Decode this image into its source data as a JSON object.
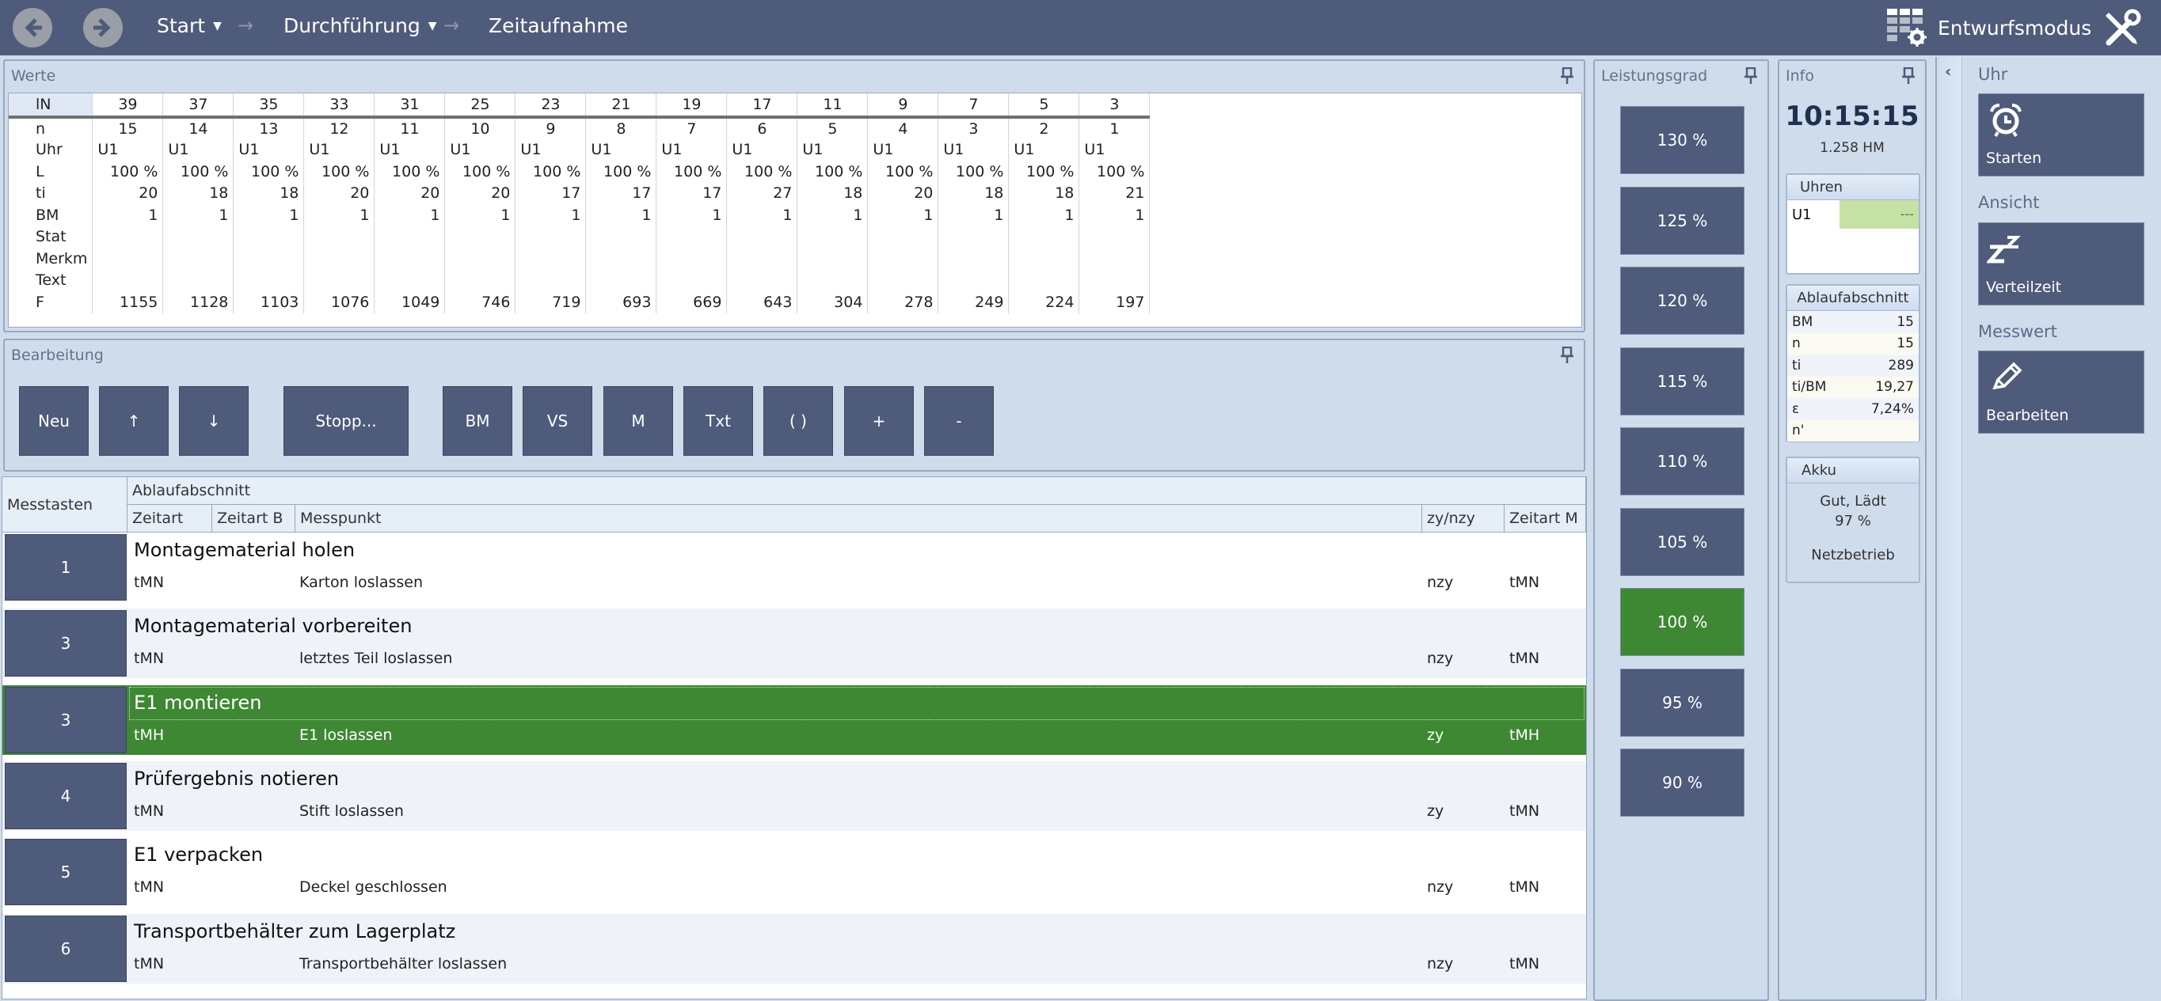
{
  "header": {
    "breadcrumbs": [
      {
        "label": "Start",
        "has_dropdown": true
      },
      {
        "label": "Durchführung",
        "has_dropdown": true
      },
      {
        "label": "Zeitaufnahme",
        "has_dropdown": false
      }
    ],
    "design_mode_label": "Entwurfsmodus",
    "icons": {
      "back": "arrow-left-circle-icon",
      "forward": "arrow-right-circle-icon",
      "design": "grid-gear-icon",
      "tools": "wrench-screwdriver-icon"
    }
  },
  "werte": {
    "title": "Werte",
    "row_labels": [
      "lN",
      "n",
      "Uhr",
      "L",
      "ti",
      "BM",
      "Stat",
      "Merkm",
      "Text",
      "F"
    ],
    "columns": [
      {
        "lN": "39",
        "n": "15",
        "Uhr": "U1",
        "L": "100 %",
        "ti": "20",
        "BM": "1",
        "Stat": "",
        "Merkm": "",
        "Text": "",
        "F": "1155"
      },
      {
        "lN": "37",
        "n": "14",
        "Uhr": "U1",
        "L": "100 %",
        "ti": "18",
        "BM": "1",
        "Stat": "",
        "Merkm": "",
        "Text": "",
        "F": "1128"
      },
      {
        "lN": "35",
        "n": "13",
        "Uhr": "U1",
        "L": "100 %",
        "ti": "18",
        "BM": "1",
        "Stat": "",
        "Merkm": "",
        "Text": "",
        "F": "1103"
      },
      {
        "lN": "33",
        "n": "12",
        "Uhr": "U1",
        "L": "100 %",
        "ti": "20",
        "BM": "1",
        "Stat": "",
        "Merkm": "",
        "Text": "",
        "F": "1076"
      },
      {
        "lN": "31",
        "n": "11",
        "Uhr": "U1",
        "L": "100 %",
        "ti": "20",
        "BM": "1",
        "Stat": "",
        "Merkm": "",
        "Text": "",
        "F": "1049"
      },
      {
        "lN": "25",
        "n": "10",
        "Uhr": "U1",
        "L": "100 %",
        "ti": "20",
        "BM": "1",
        "Stat": "",
        "Merkm": "",
        "Text": "",
        "F": "746"
      },
      {
        "lN": "23",
        "n": "9",
        "Uhr": "U1",
        "L": "100 %",
        "ti": "17",
        "BM": "1",
        "Stat": "",
        "Merkm": "",
        "Text": "",
        "F": "719"
      },
      {
        "lN": "21",
        "n": "8",
        "Uhr": "U1",
        "L": "100 %",
        "ti": "17",
        "BM": "1",
        "Stat": "",
        "Merkm": "",
        "Text": "",
        "F": "693"
      },
      {
        "lN": "19",
        "n": "7",
        "Uhr": "U1",
        "L": "100 %",
        "ti": "17",
        "BM": "1",
        "Stat": "",
        "Merkm": "",
        "Text": "",
        "F": "669"
      },
      {
        "lN": "17",
        "n": "6",
        "Uhr": "U1",
        "L": "100 %",
        "ti": "27",
        "BM": "1",
        "Stat": "",
        "Merkm": "",
        "Text": "",
        "F": "643"
      },
      {
        "lN": "11",
        "n": "5",
        "Uhr": "U1",
        "L": "100 %",
        "ti": "18",
        "BM": "1",
        "Stat": "",
        "Merkm": "",
        "Text": "",
        "F": "304"
      },
      {
        "lN": "9",
        "n": "4",
        "Uhr": "U1",
        "L": "100 %",
        "ti": "20",
        "BM": "1",
        "Stat": "",
        "Merkm": "",
        "Text": "",
        "F": "278"
      },
      {
        "lN": "7",
        "n": "3",
        "Uhr": "U1",
        "L": "100 %",
        "ti": "18",
        "BM": "1",
        "Stat": "",
        "Merkm": "",
        "Text": "",
        "F": "249"
      },
      {
        "lN": "5",
        "n": "2",
        "Uhr": "U1",
        "L": "100 %",
        "ti": "18",
        "BM": "1",
        "Stat": "",
        "Merkm": "",
        "Text": "",
        "F": "224"
      },
      {
        "lN": "3",
        "n": "1",
        "Uhr": "U1",
        "L": "100 %",
        "ti": "21",
        "BM": "1",
        "Stat": "",
        "Merkm": "",
        "Text": "",
        "F": "197"
      }
    ]
  },
  "bearbeitung": {
    "title": "Bearbeitung",
    "buttons": [
      "Neu",
      "↑",
      "↓",
      "Stopp...",
      "BM",
      "VS",
      "M",
      "Txt",
      "( )",
      "+",
      "-"
    ]
  },
  "grid": {
    "headers": {
      "messtasten": "Messtasten",
      "ablaufabschnitt": "Ablaufabschnitt",
      "zeitart": "Zeitart",
      "zeitart_b": "Zeitart B",
      "messpunkt": "Messpunkt",
      "zy_nzy": "zy/nzy",
      "zeitart_m": "Zeitart M"
    },
    "rows": [
      {
        "key": "1",
        "title": "Montagematerial holen",
        "zeitart": "tMN",
        "zeitart_b": "",
        "messpunkt": "Karton loslassen",
        "zy": "nzy",
        "zeitart_m": "tMN",
        "selected": false
      },
      {
        "key": "3",
        "title": "Montagematerial vorbereiten",
        "zeitart": "tMN",
        "zeitart_b": "",
        "messpunkt": "letztes Teil loslassen",
        "zy": "nzy",
        "zeitart_m": "tMN",
        "selected": false
      },
      {
        "key": "3",
        "title": "E1 montieren",
        "zeitart": "tMH",
        "zeitart_b": "",
        "messpunkt": "E1 loslassen",
        "zy": "zy",
        "zeitart_m": "tMH",
        "selected": true
      },
      {
        "key": "4",
        "title": "Prüfergebnis notieren",
        "zeitart": "tMN",
        "zeitart_b": "",
        "messpunkt": "Stift loslassen",
        "zy": "zy",
        "zeitart_m": "tMN",
        "selected": false
      },
      {
        "key": "5",
        "title": "E1 verpacken",
        "zeitart": "tMN",
        "zeitart_b": "",
        "messpunkt": "Deckel geschlossen",
        "zy": "nzy",
        "zeitart_m": "tMN",
        "selected": false
      },
      {
        "key": "6",
        "title": "Transportbehälter zum Lagerplatz",
        "zeitart": "tMN",
        "zeitart_b": "",
        "messpunkt": "Transportbehälter loslassen",
        "zy": "nzy",
        "zeitart_m": "tMN",
        "selected": false
      }
    ]
  },
  "leistungsgrad": {
    "title": "Leistungsgrad",
    "options": [
      "130 %",
      "125 %",
      "120 %",
      "115 %",
      "110 %",
      "105 %",
      "100 %",
      "95 %",
      "90 %"
    ],
    "selected": "100 %"
  },
  "info": {
    "title": "Info",
    "time": "10:15:15",
    "hm": "1.258 HM",
    "uhren": {
      "title": "Uhren",
      "rows": [
        {
          "label": "U1",
          "value": "---"
        }
      ]
    },
    "ablaufabschnitt": {
      "title": "Ablaufabschnitt",
      "rows": [
        {
          "label": "BM",
          "value": "15"
        },
        {
          "label": "n",
          "value": "15"
        },
        {
          "label": "ti",
          "value": "289"
        },
        {
          "label": "ti/BM",
          "value": "19,27"
        },
        {
          "label": "ε",
          "value": "7,24%"
        },
        {
          "label": "n'",
          "value": ""
        }
      ]
    },
    "akku": {
      "title": "Akku",
      "status": "Gut, Lädt",
      "percent": "97 %",
      "power": "Netzbetrieb"
    }
  },
  "ribbon": {
    "collapse_glyph": "‹",
    "groups": [
      {
        "label": "Uhr",
        "button": "Starten",
        "icon": "alarm-clock-icon"
      },
      {
        "label": "Ansicht",
        "button": "Verteilzeit",
        "icon": "sleep-zz-icon"
      },
      {
        "label": "Messwert",
        "button": "Bearbeiten",
        "icon": "pencil-icon"
      }
    ]
  },
  "colors": {
    "header_bg": "#4f5b7a",
    "button_bg": "#4f5b7a",
    "active_green": "#3e8833",
    "panel_bg": "#cfdcec",
    "clock_ok_green": "#c6e1a4"
  }
}
